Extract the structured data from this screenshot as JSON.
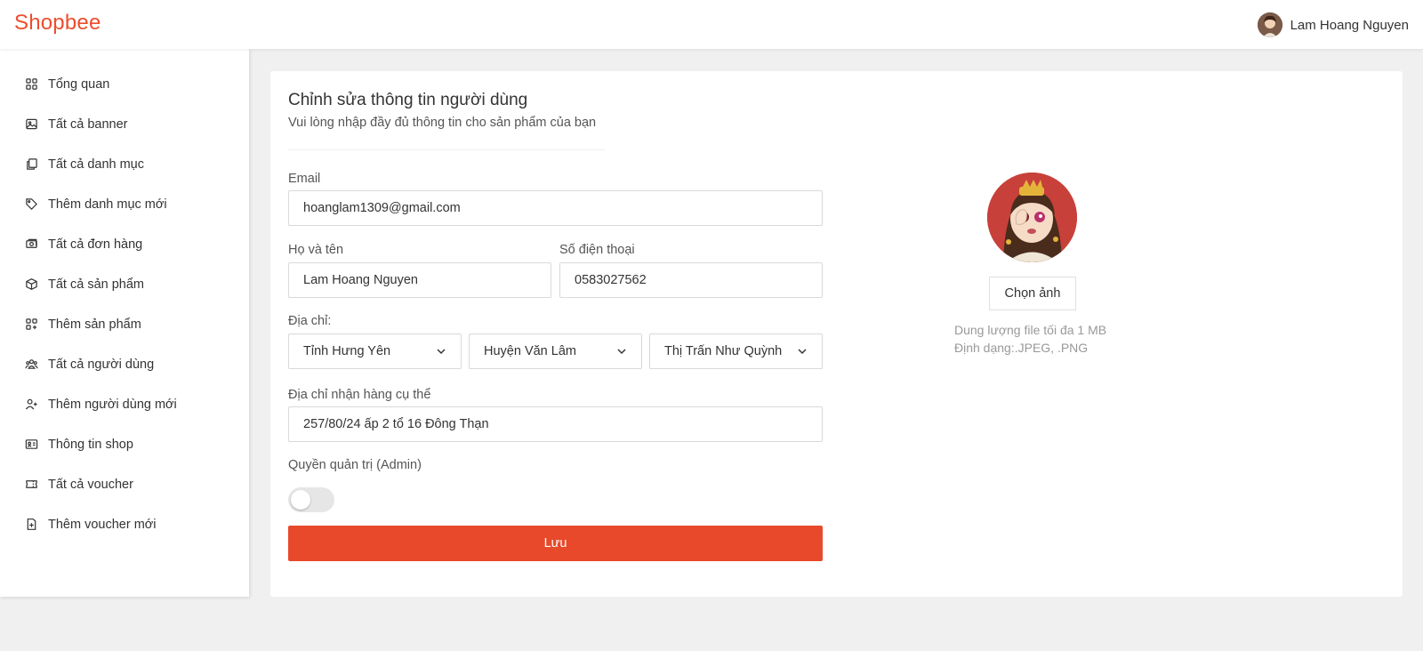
{
  "header": {
    "brand": "Shopbee",
    "user_name": "Lam Hoang Nguyen",
    "brand_color": "#ee4d2d"
  },
  "sidebar": {
    "items": [
      {
        "label": "Tổng quan",
        "icon": "grid-icon"
      },
      {
        "label": "Tất cả banner",
        "icon": "image-icon"
      },
      {
        "label": "Tất cả danh mục",
        "icon": "copy-icon"
      },
      {
        "label": "Thêm danh mục mới",
        "icon": "tag-icon"
      },
      {
        "label": "Tất cả đơn hàng",
        "icon": "cash-icon"
      },
      {
        "label": "Tất cả sản phẩm",
        "icon": "box-icon"
      },
      {
        "label": "Thêm sản phẩm",
        "icon": "grid-add-icon"
      },
      {
        "label": "Tất cả người dùng",
        "icon": "users-icon"
      },
      {
        "label": "Thêm người dùng mới",
        "icon": "user-add-icon"
      },
      {
        "label": "Thông tin shop",
        "icon": "id-card-icon"
      },
      {
        "label": "Tất cả voucher",
        "icon": "ticket-icon"
      },
      {
        "label": "Thêm voucher mới",
        "icon": "file-add-icon"
      }
    ]
  },
  "form": {
    "title": "Chỉnh sửa thông tin người dùng",
    "subtitle": "Vui lòng nhập đầy đủ thông tin cho sản phẩm của bạn",
    "email_label": "Email",
    "email_value": "hoanglam1309@gmail.com",
    "name_label": "Họ và tên",
    "name_value": "Lam Hoang Nguyen",
    "phone_label": "Số điện thoại",
    "phone_value": "0583027562",
    "address_label": "Địa chỉ:",
    "province": "Tỉnh Hưng Yên",
    "district": "Huyện Văn Lâm",
    "ward": "Thị Trấn Như Quỳnh",
    "detail_label": "Địa chỉ nhận hàng cụ thể",
    "detail_value": "257/80/24 ấp 2 tổ 16 Đông Thạn",
    "admin_label": "Quyền quản trị (Admin)",
    "admin_enabled": false,
    "save_label": "Lưu"
  },
  "avatar": {
    "choose_label": "Chọn ảnh",
    "hint_size": "Dung lượng file tối đa 1 MB",
    "hint_format": "Định dạng:.JPEG, .PNG"
  }
}
